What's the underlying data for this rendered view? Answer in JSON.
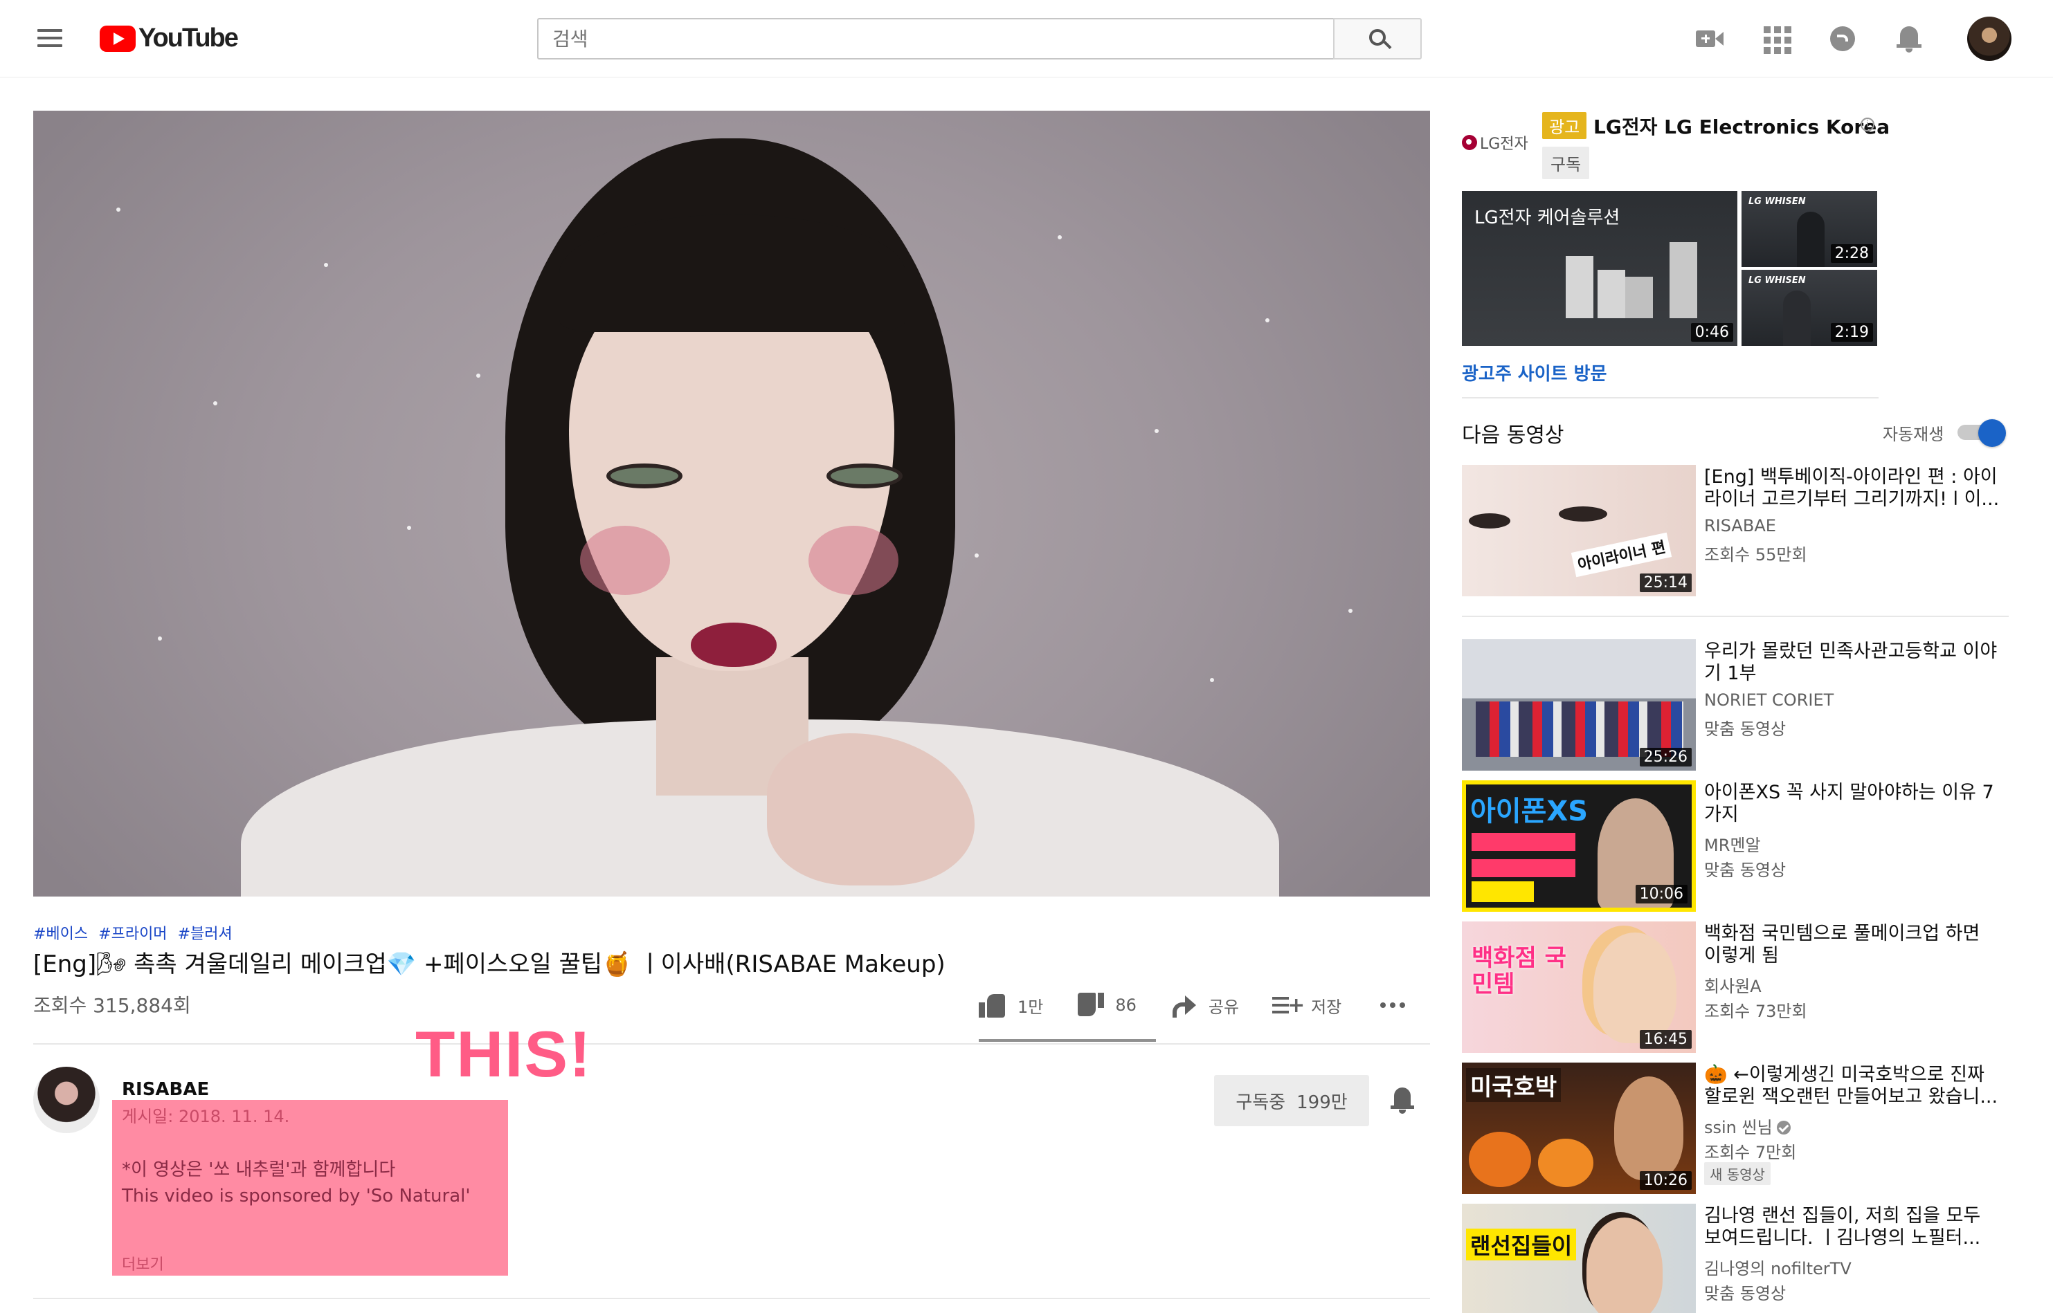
{
  "header": {
    "logo_text": "YouTube",
    "search_placeholder": "검색"
  },
  "video": {
    "tags": [
      "#베이스",
      "#프라이머",
      "#블러셔"
    ],
    "title": "[Eng]🌬 촉촉 겨울데일리 메이크업💎 +페이스오일 꿀팁🍯 ㅣ이사배(RISABAE Makeup)",
    "views": "조회수 315,884회",
    "likes": "1만",
    "dislikes": "86",
    "share_label": "공유",
    "save_label": "저장"
  },
  "overlay_text": "THIS!",
  "channel": {
    "name": "RISABAE",
    "published": "게시일: 2018. 11. 14.",
    "description_line1": "*이 영상은 '쏘 내추럴'과 함께합니다",
    "description_line2": "This video is sponsored by 'So Natural'",
    "show_more": "더보기",
    "subscribed_label": "구독중",
    "subscriber_count": "199만"
  },
  "ad": {
    "logo_text": "LG전자",
    "badge": "광고",
    "advertiser": "LG전자 LG Electronics Korea",
    "subscribe_label": "구독",
    "main_caption": "LG전자 케어솔루션",
    "main_duration": "0:46",
    "small_brand": "LG WHISEN",
    "small1_duration": "2:28",
    "small2_duration": "2:19",
    "visit_label": "광고주 사이트 방문"
  },
  "sidebar": {
    "up_next_label": "다음 동영상",
    "autoplay_label": "자동재생",
    "autoplay_on": true,
    "recommendations": [
      {
        "title": "[Eng] 백투베이직-아이라인 편 : 아이라이너 고르기부터 그리기까지! l 이...",
        "channel": "RISABAE",
        "meta": "조회수 55만회",
        "duration": "25:14",
        "thumb_caption": "아이라이너 편"
      },
      {
        "title": "우리가 몰랐던 민족사관고등학교 이야기 1부",
        "channel": "NORIET CORIET",
        "meta": "맞춤 동영상",
        "duration": "25:26"
      },
      {
        "title": "아이폰XS 꼭 사지 말아야하는 이유 7가지",
        "channel": "MR멘알",
        "meta": "맞춤 동영상",
        "duration": "10:06",
        "thumb_caption": "아이폰XS"
      },
      {
        "title": "백화점 국민템으로 풀메이크업 하면 이렇게 됨",
        "channel": "회사원A",
        "meta": "조회수 73만회",
        "duration": "16:45",
        "thumb_caption": "백화점 국민템"
      },
      {
        "title": "🎃 ←이렇게생긴 미국호박으로 진짜 할로윈 잭오랜턴 만들어보고 왔습니...",
        "channel": "ssin 씬님",
        "meta": "조회수 7만회",
        "badge": "새 동영상",
        "duration": "10:26",
        "thumb_caption": "미국호박"
      },
      {
        "title": "김나영 랜선 집들이, 저희 집을 모두 보여드립니다. ㅣ김나영의 노필터...",
        "channel": "김나영의 nofilterTV",
        "meta": "맞춤 동영상",
        "thumb_caption": "랜선집들이"
      }
    ]
  },
  "colors": {
    "brand_red": "#ff0000",
    "link_blue": "#1a63c7",
    "overlay_pink": "#ff5c86",
    "ad_badge": "#e5b51d"
  }
}
